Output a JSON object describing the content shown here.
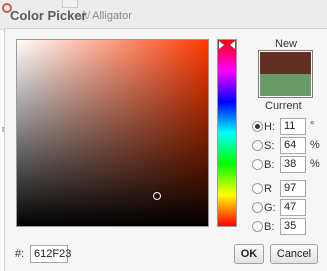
{
  "dialog": {
    "title": "Color Picker",
    "background_label": "Alligator",
    "background_side_text": "n"
  },
  "preview": {
    "new_label": "New",
    "current_label": "Current",
    "new_color": "#612F23",
    "current_color": "#6B9A68"
  },
  "hsb": {
    "h": {
      "label": "H:",
      "value": "11",
      "unit": "°",
      "selected": true
    },
    "s": {
      "label": "S:",
      "value": "64",
      "unit": "%",
      "selected": false
    },
    "b": {
      "label": "B:",
      "value": "38",
      "unit": "%",
      "selected": false
    }
  },
  "rgb": {
    "r": {
      "label": "R",
      "value": "97",
      "selected": false
    },
    "g": {
      "label": "G:",
      "value": "47",
      "selected": false
    },
    "b": {
      "label": "B:",
      "value": "35",
      "selected": false
    }
  },
  "hex": {
    "label": "#:",
    "value": "612F23"
  },
  "buttons": {
    "ok": "OK",
    "cancel": "Cancel"
  },
  "colors": {
    "field_hue": "#FF3A00",
    "dialog_bg": "#F6F6F6"
  },
  "icons": {
    "hue_slider_arrows": "slider-arrow-icon",
    "sv_marker": "crosshair-circle-icon"
  }
}
